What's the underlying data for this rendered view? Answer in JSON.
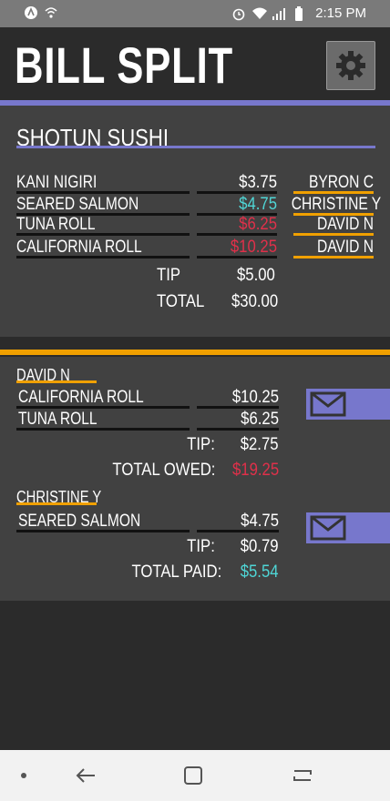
{
  "status_bar": {
    "time": "2:15 PM",
    "icons_left": [
      "a-icon",
      "wifi-call-icon"
    ],
    "icons_right": [
      "alarm-icon",
      "wifi-icon",
      "signal-icon",
      "battery-icon"
    ]
  },
  "header": {
    "title": "BILL SPLIT",
    "settings_icon": "gear-icon"
  },
  "colors": {
    "accent_purple": "#7777cc",
    "accent_orange": "#f0a000",
    "teal": "#4fd6d6",
    "red": "#e0304a",
    "card": "#414141",
    "background": "#2b2b2b"
  },
  "receipt": {
    "restaurant": "SHOTUN SUSHI",
    "items": [
      {
        "name": "KANI NIGIRI",
        "price": "$3.75",
        "assigned": "BYRON C",
        "price_color": "#ffffff"
      },
      {
        "name": "SEARED SALMON",
        "price": "$4.75",
        "assigned": "CHRISTINE Y",
        "price_color": "#4fd6d6"
      },
      {
        "name": "TUNA ROLL",
        "price": "$6.25",
        "assigned": "DAVID N",
        "price_color": "#e0304a"
      },
      {
        "name": "CALIFORNIA ROLL",
        "price": "$10.25",
        "assigned": "DAVID N",
        "price_color": "#e0304a"
      }
    ],
    "tip_label": "TIP",
    "tip": "$5.00",
    "total_label": "TOTAL",
    "total": "$30.00"
  },
  "split": [
    {
      "person": "DAVID N",
      "items": [
        {
          "name": "CALIFORNIA ROLL",
          "price": "$10.25"
        },
        {
          "name": "TUNA ROLL",
          "price": "$6.25"
        }
      ],
      "tip_label": "TIP:",
      "tip": "$2.75",
      "total_label": "TOTAL OWED:",
      "total": "$19.25",
      "total_color": "#e0304a"
    },
    {
      "person": "CHRISTINE Y",
      "items": [
        {
          "name": "SEARED SALMON",
          "price": "$4.75"
        }
      ],
      "tip_label": "TIP:",
      "tip": "$0.79",
      "total_label": "TOTAL PAID:",
      "total": "$5.54",
      "total_color": "#4fd6d6"
    }
  ],
  "nav": {
    "items": [
      "dot-icon",
      "back-icon",
      "home-icon",
      "recents-icon"
    ]
  }
}
